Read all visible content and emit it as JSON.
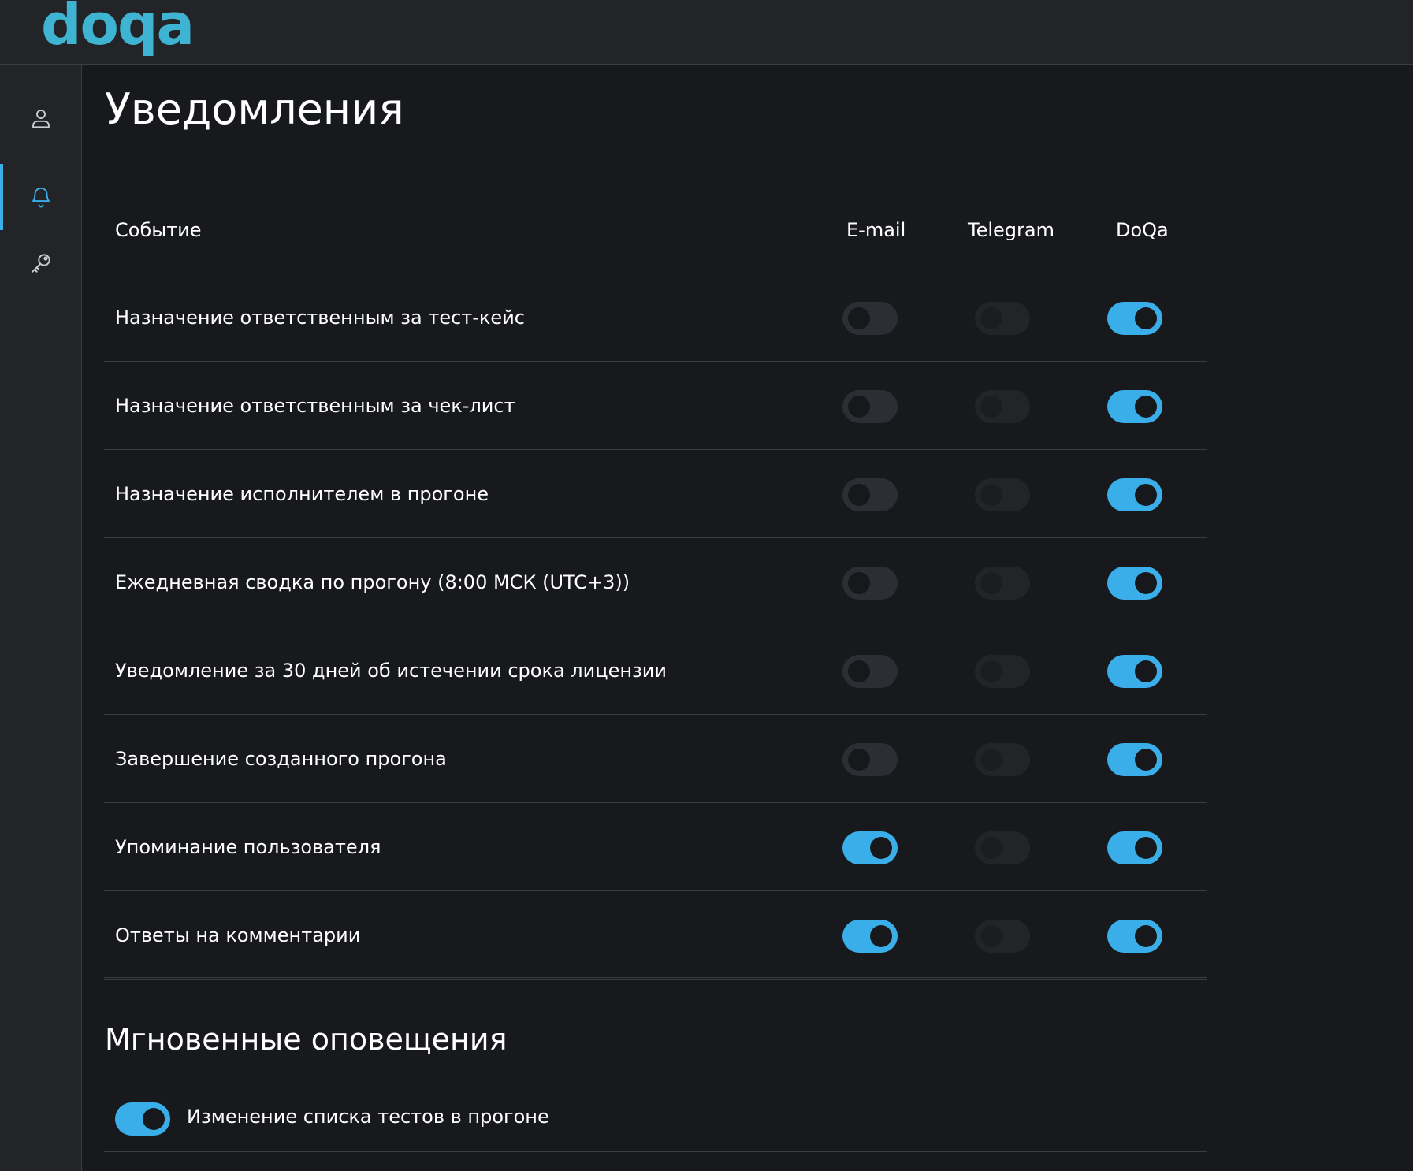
{
  "app": {
    "logo_text": "doqa",
    "accent_color": "#3aaee8",
    "logo_color": "#3fb4d2"
  },
  "sidebar": {
    "items": [
      {
        "icon": "user-icon",
        "active": false
      },
      {
        "icon": "bell-icon",
        "active": true
      },
      {
        "icon": "key-icon",
        "active": false
      }
    ]
  },
  "page": {
    "title": "Уведомления"
  },
  "table": {
    "columns": {
      "event": "Событие",
      "email": "E-mail",
      "telegram": "Telegram",
      "doqa": "DoQa"
    },
    "rows": [
      {
        "label": "Назначение ответственным за тест-кейс",
        "email": false,
        "telegram": false,
        "doqa": true
      },
      {
        "label": "Назначение ответственным за чек-лист",
        "email": false,
        "telegram": false,
        "doqa": true
      },
      {
        "label": "Назначение исполнителем в прогоне",
        "email": false,
        "telegram": false,
        "doqa": true
      },
      {
        "label": "Ежедневная сводка по прогону (8:00 МСК (UTC+3))",
        "email": false,
        "telegram": false,
        "doqa": true
      },
      {
        "label": "Уведомление за 30 дней об истечении срока лицензии",
        "email": false,
        "telegram": false,
        "doqa": true
      },
      {
        "label": "Завершение созданного прогона",
        "email": false,
        "telegram": false,
        "doqa": true
      },
      {
        "label": "Упоминание пользователя",
        "email": true,
        "telegram": false,
        "doqa": true
      },
      {
        "label": "Ответы на комментарии",
        "email": true,
        "telegram": false,
        "doqa": true
      }
    ],
    "telegram_disabled": true
  },
  "instant": {
    "title": "Мгновенные оповещения",
    "items": [
      {
        "label": "Изменение списка тестов в прогоне",
        "enabled": true
      }
    ]
  }
}
